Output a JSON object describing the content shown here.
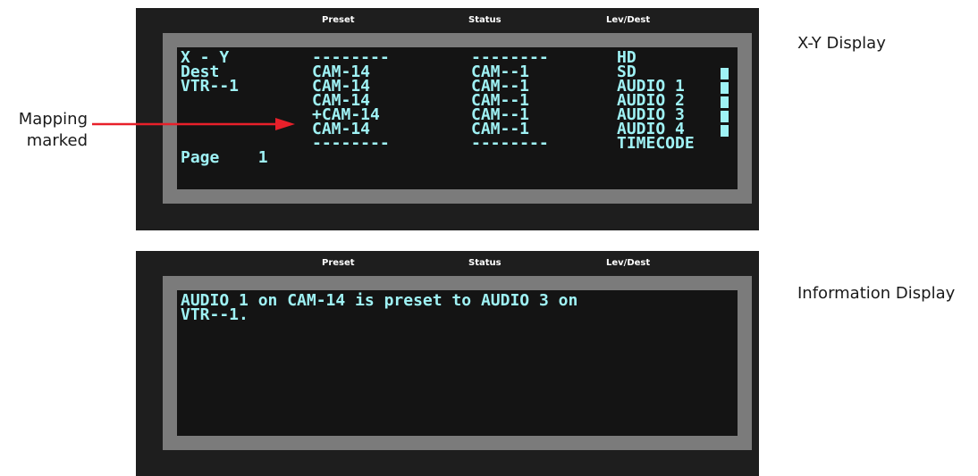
{
  "header": {
    "preset": "Preset",
    "status": "Status",
    "lev_dest": "Lev/Dest"
  },
  "xy_display": {
    "label": "X-Y Display",
    "left_col": [
      "X - Y",
      "Dest",
      "VTR--1",
      "",
      "",
      "",
      "",
      "Page    1"
    ],
    "preset_col": [
      "--------",
      "CAM-14",
      "CAM-14",
      "CAM-14",
      "+CAM-14",
      "CAM-14",
      "--------",
      ""
    ],
    "status_col": [
      "--------",
      "CAM--1",
      "CAM--1",
      "CAM--1",
      "CAM--1",
      "CAM--1",
      "--------",
      ""
    ],
    "levdest_col": [
      "HD",
      "SD",
      "AUDIO 1",
      "AUDIO 2",
      "AUDIO 3",
      "AUDIO 4",
      "TIMECODE",
      ""
    ]
  },
  "info_display": {
    "label": "Information Display",
    "message_line1": "AUDIO 1 on CAM-14 is preset to AUDIO 3 on",
    "message_line2": "VTR--1."
  },
  "callout": {
    "line1": "Mapping",
    "line2": "marked"
  },
  "colors": {
    "lcd_text": "#9ff2f5",
    "panel": "#1e1e1e",
    "bezel": "#7b7b7b",
    "arrow": "#e8202a"
  }
}
